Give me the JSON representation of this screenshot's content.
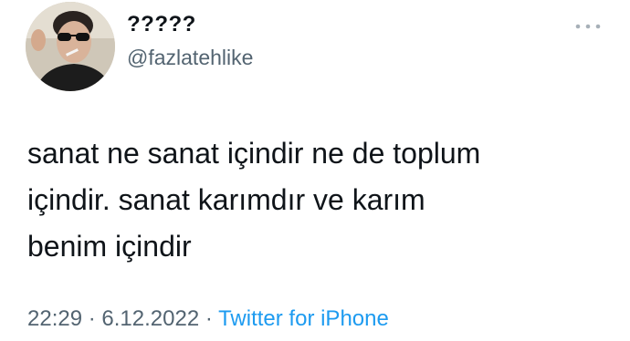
{
  "tweet": {
    "display_name": "?????",
    "handle": "@fazlatehlike",
    "more_icon": "more-horizontal-icon",
    "text": "sanat ne sanat içindir ne de toplum\niçindir. sanat karımdır ve karım\nbenim içindir",
    "time": "22:29",
    "separator_1": " · ",
    "date": "6.12.2022",
    "separator_2": " · ",
    "source": "Twitter for iPhone",
    "source_color": "#1d9bf0",
    "muted_color": "#536471",
    "text_color": "#0f1419"
  }
}
